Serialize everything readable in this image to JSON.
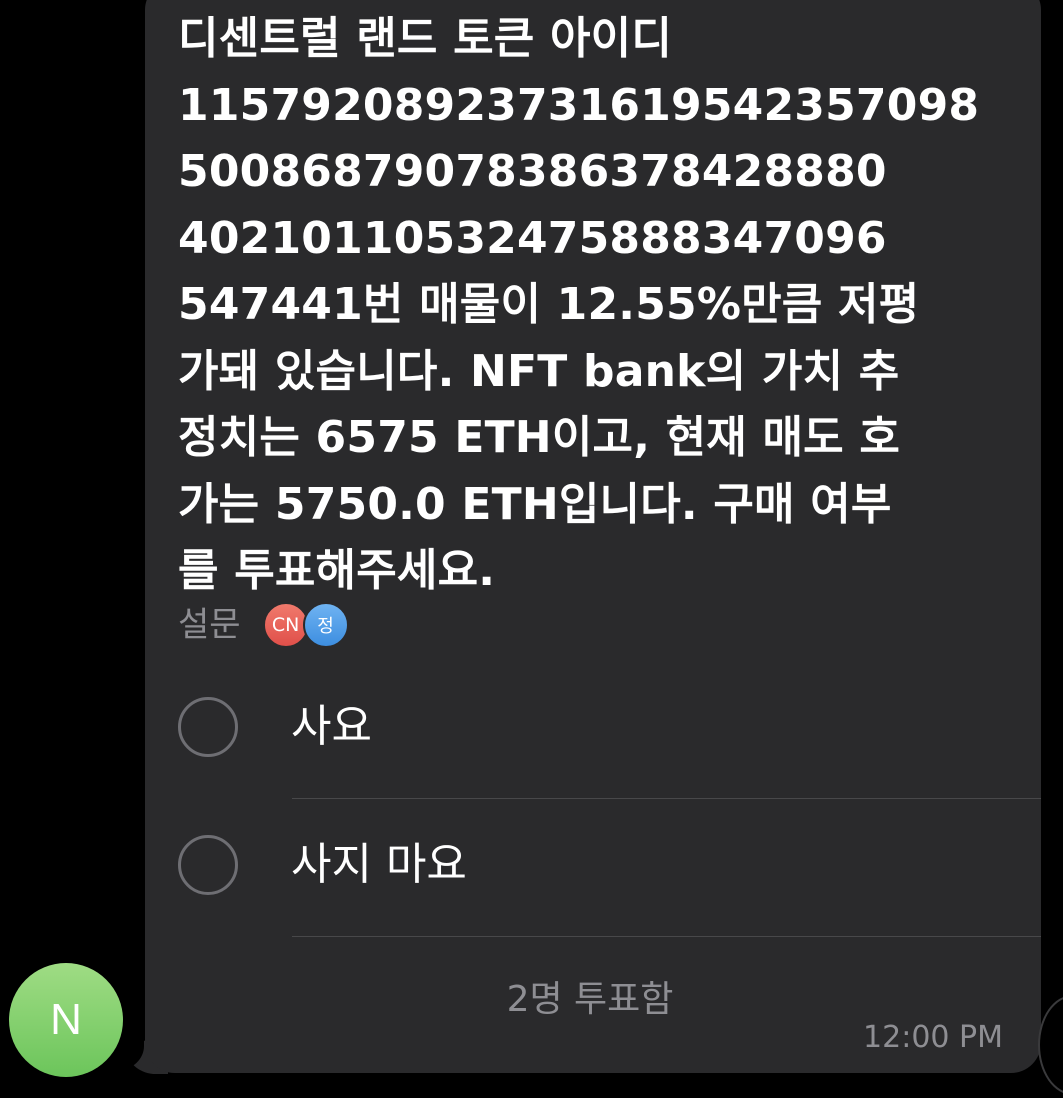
{
  "message": {
    "lines": [
      "디센트럴 랜드 토큰 아이디",
      "11579208923731619542357098",
      "50086879078386378428880",
      "40210110532475888347096",
      "547441번 매물이 12.55%만큼 저평",
      "가돼 있습니다. NFT bank의 가치 추",
      "정치는 6575 ETH이고, 현재 매도 호",
      "가는 5750.0 ETH입니다. 구매 여부",
      "를 투표해주세요."
    ],
    "survey_label": "설문",
    "voters": [
      "CN",
      "정"
    ],
    "options": [
      "사요",
      "사지 마요"
    ],
    "vote_count": "2명 투표함",
    "time": "12:00 PM"
  },
  "sender": {
    "avatar_initial": "N",
    "avatar_color": "#7ccf68"
  },
  "colors": {
    "background": "#000000",
    "bubble": "#2a2a2c",
    "text": "#ffffff",
    "muted": "#8e8e93"
  }
}
